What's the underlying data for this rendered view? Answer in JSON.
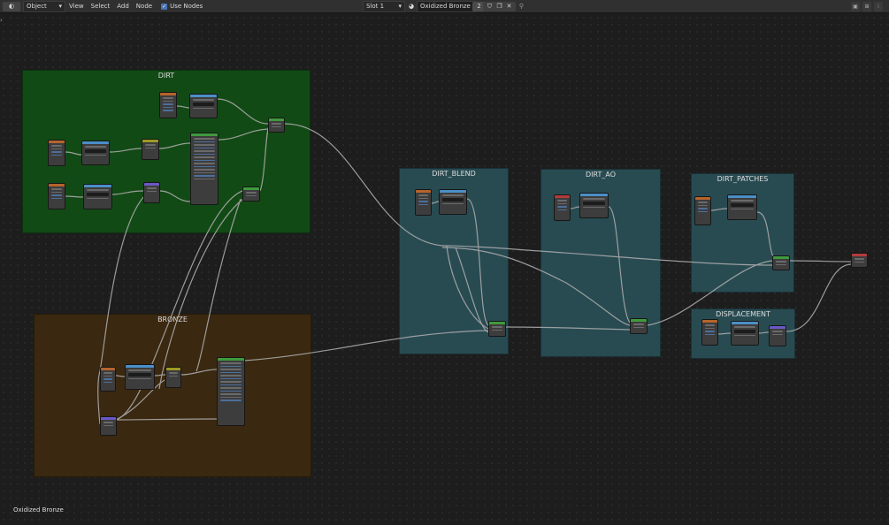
{
  "header": {
    "mode": "Object",
    "menus": [
      "View",
      "Select",
      "Add",
      "Node"
    ],
    "use_nodes_label": "Use Nodes",
    "slot": "Slot 1",
    "material_name": "Oxidized Bronze",
    "user_count": "2"
  },
  "frames": {
    "dirt": "DIRT",
    "bronze": "BRONZE",
    "dirt_blend": "DIRT_BLEND",
    "dirt_ao": "DIRT_AO",
    "dirt_patches": "DIRT_PATCHES",
    "displacement": "DISPLACEMENT"
  },
  "footer": {
    "material_name": "Oxidized Bronze"
  },
  "colors": {
    "frame_dirt": "#124a15",
    "frame_bronze": "#3a2810",
    "frame_teal": "#284b52",
    "header_texcoord": "#b5642c",
    "header_color": "#9e9a22",
    "header_vector": "#6b58c7",
    "header_shader": "#3f9a3d",
    "header_converter": "#4a8fc7",
    "header_input": "#b33b3b",
    "header_output": "#b33b3b"
  }
}
